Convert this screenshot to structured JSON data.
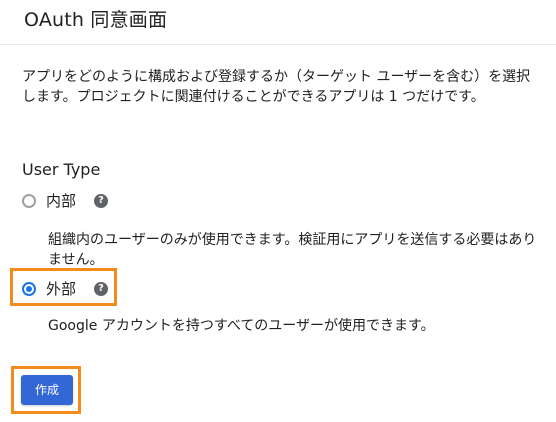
{
  "header": {
    "title": "OAuth 同意画面"
  },
  "description": "アプリをどのように構成および登録するか（ターゲット ユーザーを含む）を選択します。プロジェクトに関連付けることができるアプリは 1 つだけです。",
  "user_type": {
    "heading": "User Type",
    "options": [
      {
        "label": "内部",
        "selected": false,
        "help_icon": "help-circle-icon",
        "description": "組織内のユーザーのみが使用できます。検証用にアプリを送信する必要はありません。"
      },
      {
        "label": "外部",
        "selected": true,
        "help_icon": "help-circle-icon",
        "description": "Google アカウントを持つすべてのユーザーが使用できます。"
      }
    ]
  },
  "actions": {
    "create_label": "作成"
  },
  "colors": {
    "accent": "#1a73e8",
    "button": "#3367d6",
    "highlight": "#f28b1c",
    "help_icon": "#5f6368"
  }
}
